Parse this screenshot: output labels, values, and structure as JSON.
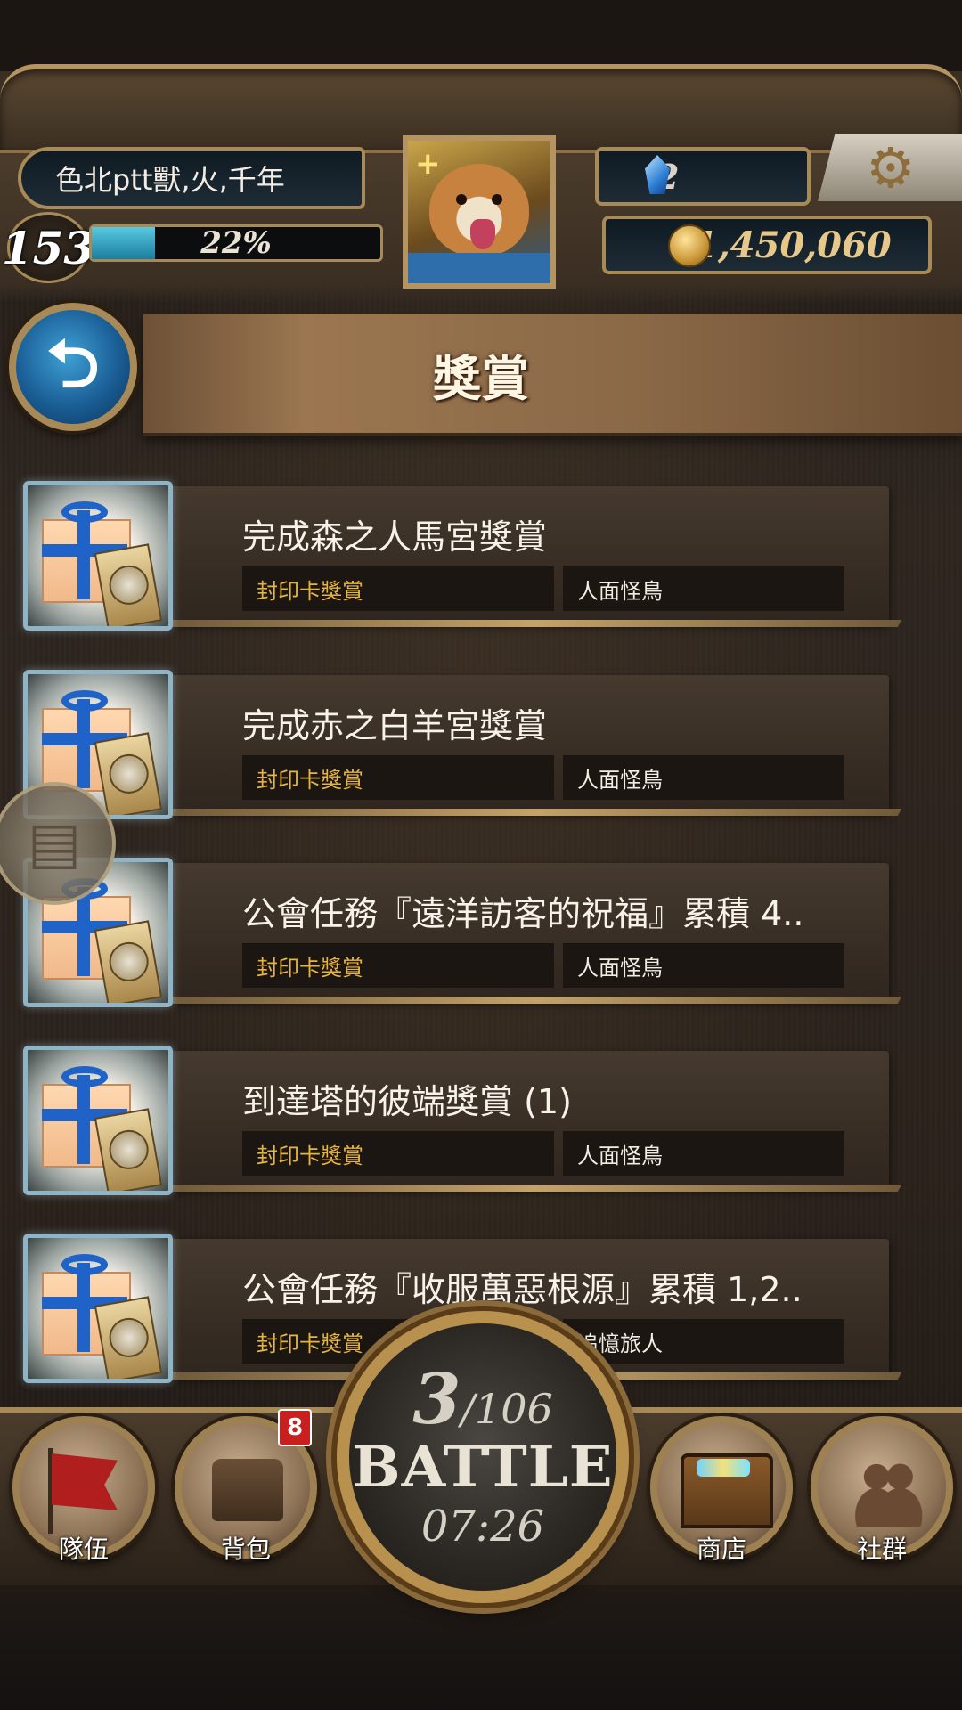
{
  "header": {
    "player_name": "色北ptt獸,火,千年",
    "level": "153",
    "exp_percent_text": "22%",
    "exp_fraction": 0.22,
    "gems": "2",
    "coins": "1,450,060",
    "avatar_plus": "+",
    "icons": {
      "gem": "blue-gem-icon",
      "coin": "gold-coin-icon",
      "settings": "gear-icon"
    }
  },
  "title_bar": {
    "title": "獎賞",
    "back_icon": "⮌"
  },
  "rewards": [
    {
      "title": "完成森之人馬宮獎賞",
      "type": "封印卡獎賞",
      "source": "人面怪鳥"
    },
    {
      "title": "完成赤之白羊宮獎賞",
      "type": "封印卡獎賞",
      "source": "人面怪鳥"
    },
    {
      "title": "公會任務『遠洋訪客的祝福』累積 4..",
      "type": "封印卡獎賞",
      "source": "人面怪鳥"
    },
    {
      "title": "到達塔的彼端獎賞 (1)",
      "type": "封印卡獎賞",
      "source": "人面怪鳥"
    },
    {
      "title": "公會任務『收服萬惡根源』累積 1,2..",
      "type": "封印卡獎賞",
      "source": "追憶旅人"
    }
  ],
  "bottom_nav": {
    "team": "隊伍",
    "bag": "背包",
    "bag_badge": "8",
    "shop": "商店",
    "social": "社群"
  },
  "battle": {
    "current": "3",
    "separator": "/",
    "total": "106",
    "label": "BATTLE",
    "timer": "07:26"
  },
  "colors": {
    "accent_gold": "#a88a58",
    "reward_type_text": "#e6b440",
    "badge_red": "#c81f1f",
    "exp_fill": "#3fb0cf"
  }
}
